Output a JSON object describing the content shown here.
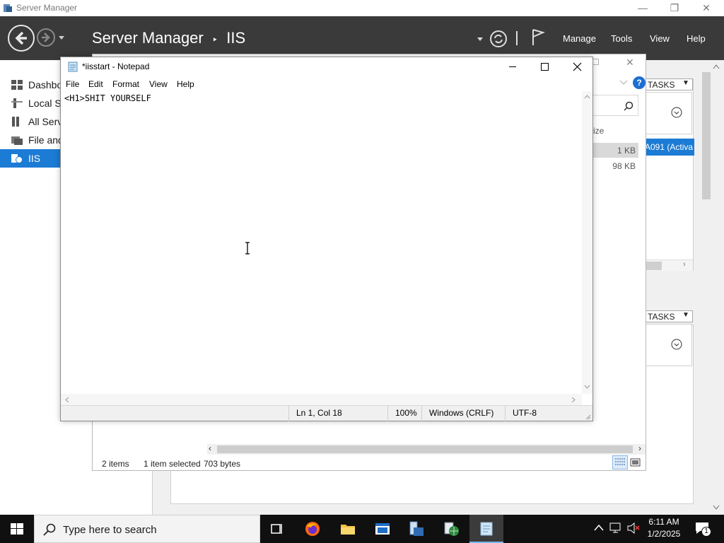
{
  "server_manager": {
    "window_title": "Server Manager",
    "header": {
      "app_name": "Server Manager",
      "separator": "‣",
      "section": "IIS",
      "menus": [
        "Manage",
        "Tools",
        "View",
        "Help"
      ]
    },
    "nav": {
      "items": [
        {
          "label": "Dashbo",
          "icon": "dashboard-icon"
        },
        {
          "label": "Local Se",
          "icon": "local-server-icon"
        },
        {
          "label": "All Serv",
          "icon": "all-servers-icon"
        },
        {
          "label": "File and",
          "icon": "file-storage-icon"
        },
        {
          "label": "IIS",
          "icon": "iis-icon",
          "selected": true
        }
      ]
    },
    "tasks_label": "TASKS",
    "server_row_text": "A091 (Activa"
  },
  "explorer": {
    "column_header": "ize",
    "rows": [
      {
        "size": "1 KB"
      },
      {
        "size": "98 KB"
      }
    ],
    "status": {
      "items": "2 items",
      "selected": "1 item selected",
      "size": "703 bytes"
    }
  },
  "notepad": {
    "title": "*iisstart - Notepad",
    "menus": [
      "File",
      "Edit",
      "Format",
      "View",
      "Help"
    ],
    "content": "<H1>SHIT YOURSELF",
    "status": {
      "position": "Ln 1, Col 18",
      "zoom": "100%",
      "line_ending": "Windows (CRLF)",
      "encoding": "UTF-8"
    }
  },
  "taskbar": {
    "search_placeholder": "Type here to search",
    "clock_time": "6:11 AM",
    "clock_date": "1/2/2025",
    "notification_count": "1"
  },
  "colors": {
    "header_bg": "#3a3a3a",
    "selection_blue": "#1c7bd4",
    "taskbar_bg": "#101010"
  }
}
